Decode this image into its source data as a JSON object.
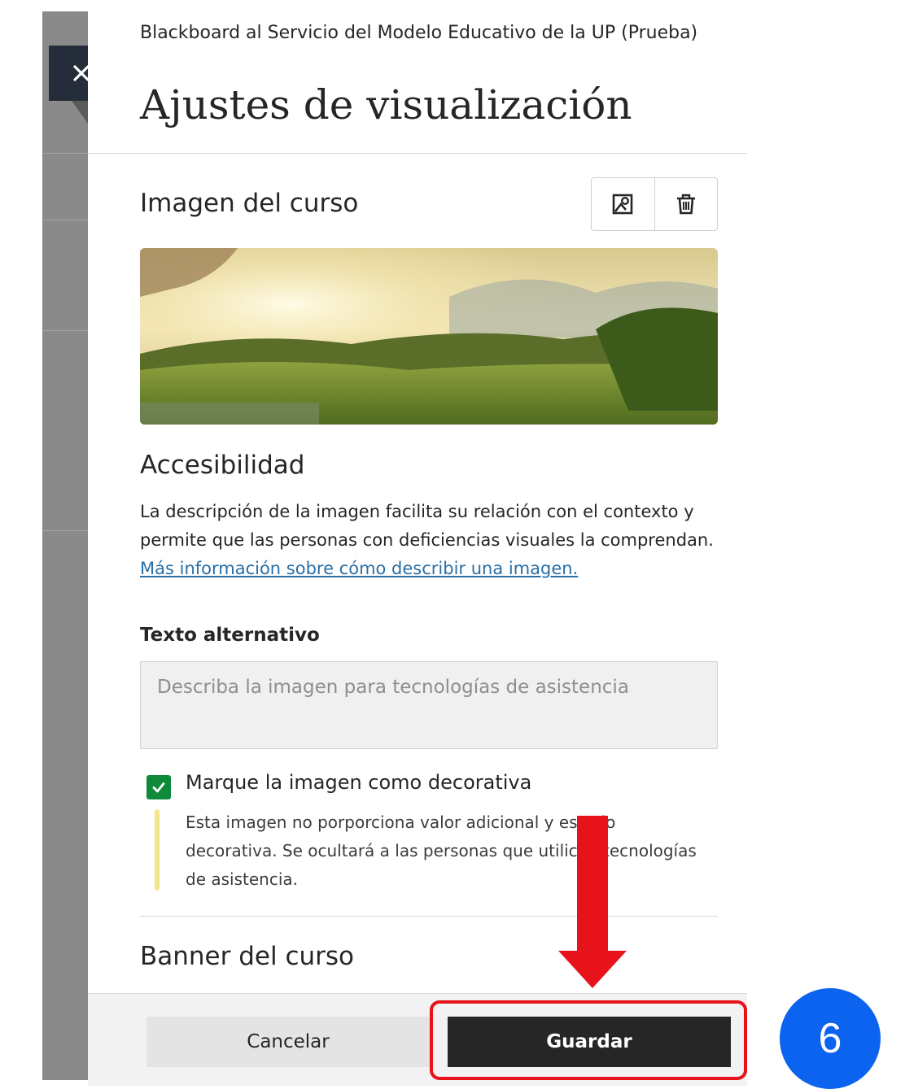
{
  "panel": {
    "context": "Blackboard al Servicio del Modelo Educativo de la UP (Prueba)",
    "title": "Ajustes de visualización"
  },
  "course_image": {
    "heading": "Imagen del curso",
    "change_icon": "image-edit-icon",
    "delete_icon": "trash-icon"
  },
  "accessibility": {
    "heading": "Accesibilidad",
    "description": "La descripción de la imagen facilita su relación con el contexto y permite que las personas con deficiencias visuales la comprendan.",
    "link": "Más información sobre cómo describir una imagen.",
    "alt_label": "Texto alternativo",
    "alt_placeholder": "Describa la imagen para tecnologías de asistencia",
    "alt_value": "",
    "decorative_label": "Marque la imagen como decorativa",
    "decorative_checked": true,
    "decorative_note": "Esta imagen no porporciona valor adicional y es solo decorativa. Se ocultará a las personas que utilicen tecnologías de asistencia."
  },
  "banner": {
    "heading": "Banner del curso"
  },
  "footer": {
    "cancel_label": "Cancelar",
    "save_label": "Guardar"
  },
  "annotation": {
    "step_number": "6",
    "accent_color": "#e8121b",
    "badge_color": "#0b63f0"
  }
}
